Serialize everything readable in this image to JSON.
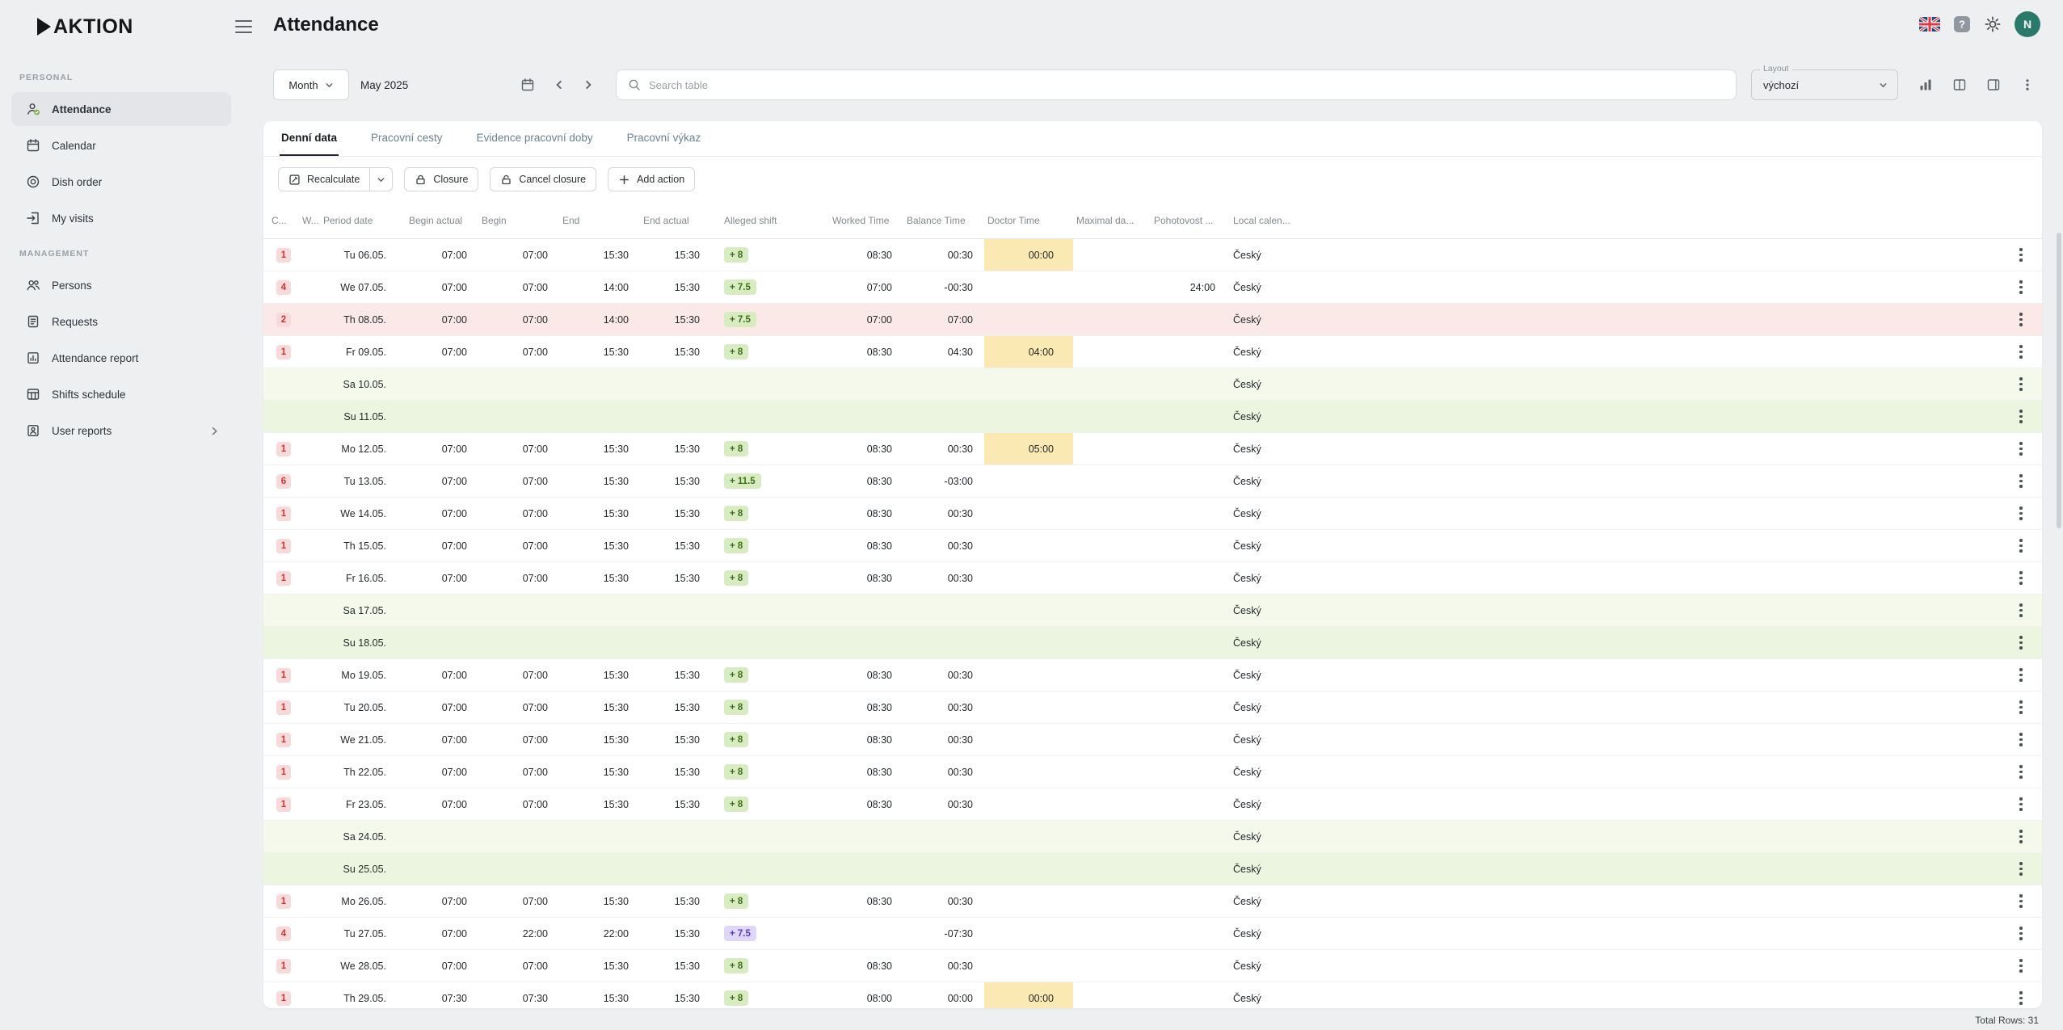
{
  "brand": {
    "logo_text": "AKTION"
  },
  "sidebar": {
    "sections": [
      {
        "label": "PERSONAL",
        "items": [
          {
            "id": "attendance",
            "label": "Attendance",
            "icon": "attendance-icon",
            "active": true
          },
          {
            "id": "calendar",
            "label": "Calendar",
            "icon": "calendar-icon"
          },
          {
            "id": "dish-order",
            "label": "Dish order",
            "icon": "dish-icon"
          },
          {
            "id": "my-visits",
            "label": "My visits",
            "icon": "visits-icon"
          }
        ]
      },
      {
        "label": "MANAGEMENT",
        "items": [
          {
            "id": "persons",
            "label": "Persons",
            "icon": "persons-icon"
          },
          {
            "id": "requests",
            "label": "Requests",
            "icon": "requests-icon"
          },
          {
            "id": "attendance-report",
            "label": "Attendance report",
            "icon": "report-icon"
          },
          {
            "id": "shifts-schedule",
            "label": "Shifts schedule",
            "icon": "schedule-icon"
          },
          {
            "id": "user-reports",
            "label": "User reports",
            "icon": "user-reports-icon",
            "chevron": true
          }
        ]
      }
    ]
  },
  "header": {
    "title": "Attendance",
    "avatar_initial": "N"
  },
  "toolbar": {
    "period_mode": "Month",
    "period_value": "May 2025",
    "search_placeholder": "Search table",
    "layout_label": "Layout",
    "layout_value": "výchozí"
  },
  "tabs": [
    {
      "id": "denni-data",
      "label": "Denní data",
      "active": true
    },
    {
      "id": "pracovni-cesty",
      "label": "Pracovní cesty"
    },
    {
      "id": "evidence-pracovni-doby",
      "label": "Evidence pracovní doby"
    },
    {
      "id": "pracovni-vykaz",
      "label": "Pracovní výkaz"
    }
  ],
  "actions": {
    "recalculate": "Recalculate",
    "closure": "Closure",
    "cancel_closure": "Cancel closure",
    "add_action": "Add action"
  },
  "table": {
    "columns": [
      {
        "id": "count",
        "label": "C..."
      },
      {
        "id": "week",
        "label": "W..."
      },
      {
        "id": "period-date",
        "label": "Period date"
      },
      {
        "id": "begin-actual",
        "label": "Begin actual"
      },
      {
        "id": "begin",
        "label": "Begin"
      },
      {
        "id": "end",
        "label": "End"
      },
      {
        "id": "end-actual",
        "label": "End actual"
      },
      {
        "id": "alleged-shift",
        "label": "Alleged shift"
      },
      {
        "id": "worked-time",
        "label": "Worked Time"
      },
      {
        "id": "balance-time",
        "label": "Balance Time"
      },
      {
        "id": "doctor-time",
        "label": "Doctor Time"
      },
      {
        "id": "maximal-day",
        "label": "Maximal da..."
      },
      {
        "id": "standby",
        "label": "Pohotovost ..."
      },
      {
        "id": "local-calendar",
        "label": "Local calen..."
      }
    ],
    "rows": [
      {
        "count": "1",
        "date": "Tu 06.05.",
        "begin_actual": "07:00",
        "begin": "07:00",
        "end": "15:30",
        "end_actual": "15:30",
        "shift": "+ 8",
        "shift_style": "green",
        "worked": "08:30",
        "balance": "00:30",
        "doctor": "00:00",
        "maximal": "",
        "standby": "",
        "calendar": "Český",
        "style": "normal"
      },
      {
        "count": "4",
        "date": "We 07.05.",
        "begin_actual": "07:00",
        "begin": "07:00",
        "end": "14:00",
        "end_actual": "15:30",
        "shift": "+ 7.5",
        "shift_style": "green",
        "worked": "07:00",
        "balance": "-00:30",
        "doctor": "",
        "maximal": "",
        "standby": "24:00",
        "calendar": "Český",
        "style": "normal"
      },
      {
        "count": "2",
        "date": "Th 08.05.",
        "begin_actual": "07:00",
        "begin": "07:00",
        "end": "14:00",
        "end_actual": "15:30",
        "shift": "+ 7.5",
        "shift_style": "green",
        "worked": "07:00",
        "balance": "07:00",
        "doctor": "",
        "maximal": "",
        "standby": "",
        "calendar": "Český",
        "style": "alert"
      },
      {
        "count": "1",
        "date": "Fr 09.05.",
        "begin_actual": "07:00",
        "begin": "07:00",
        "end": "15:30",
        "end_actual": "15:30",
        "shift": "+ 8",
        "shift_style": "green",
        "worked": "08:30",
        "balance": "04:30",
        "doctor": "04:00",
        "maximal": "",
        "standby": "",
        "calendar": "Český",
        "style": "normal"
      },
      {
        "count": "",
        "date": "Sa 10.05.",
        "begin_actual": "",
        "begin": "",
        "end": "",
        "end_actual": "",
        "shift": "",
        "shift_style": "",
        "worked": "",
        "balance": "",
        "doctor": "",
        "maximal": "",
        "standby": "",
        "calendar": "Český",
        "style": "weekend-sa"
      },
      {
        "count": "",
        "date": "Su 11.05.",
        "begin_actual": "",
        "begin": "",
        "end": "",
        "end_actual": "",
        "shift": "",
        "shift_style": "",
        "worked": "",
        "balance": "",
        "doctor": "",
        "maximal": "",
        "standby": "",
        "calendar": "Český",
        "style": "weekend-su"
      },
      {
        "count": "1",
        "date": "Mo 12.05.",
        "begin_actual": "07:00",
        "begin": "07:00",
        "end": "15:30",
        "end_actual": "15:30",
        "shift": "+ 8",
        "shift_style": "green",
        "worked": "08:30",
        "balance": "00:30",
        "doctor": "05:00",
        "maximal": "",
        "standby": "",
        "calendar": "Český",
        "style": "normal"
      },
      {
        "count": "6",
        "date": "Tu 13.05.",
        "begin_actual": "07:00",
        "begin": "07:00",
        "end": "15:30",
        "end_actual": "15:30",
        "shift": "+ 11.5",
        "shift_style": "green",
        "worked": "08:30",
        "balance": "-03:00",
        "doctor": "",
        "maximal": "",
        "standby": "",
        "calendar": "Český",
        "style": "normal"
      },
      {
        "count": "1",
        "date": "We 14.05.",
        "begin_actual": "07:00",
        "begin": "07:00",
        "end": "15:30",
        "end_actual": "15:30",
        "shift": "+ 8",
        "shift_style": "green",
        "worked": "08:30",
        "balance": "00:30",
        "doctor": "",
        "maximal": "",
        "standby": "",
        "calendar": "Český",
        "style": "normal"
      },
      {
        "count": "1",
        "date": "Th 15.05.",
        "begin_actual": "07:00",
        "begin": "07:00",
        "end": "15:30",
        "end_actual": "15:30",
        "shift": "+ 8",
        "shift_style": "green",
        "worked": "08:30",
        "balance": "00:30",
        "doctor": "",
        "maximal": "",
        "standby": "",
        "calendar": "Český",
        "style": "normal"
      },
      {
        "count": "1",
        "date": "Fr 16.05.",
        "begin_actual": "07:00",
        "begin": "07:00",
        "end": "15:30",
        "end_actual": "15:30",
        "shift": "+ 8",
        "shift_style": "green",
        "worked": "08:30",
        "balance": "00:30",
        "doctor": "",
        "maximal": "",
        "standby": "",
        "calendar": "Český",
        "style": "normal"
      },
      {
        "count": "",
        "date": "Sa 17.05.",
        "begin_actual": "",
        "begin": "",
        "end": "",
        "end_actual": "",
        "shift": "",
        "shift_style": "",
        "worked": "",
        "balance": "",
        "doctor": "",
        "maximal": "",
        "standby": "",
        "calendar": "Český",
        "style": "weekend-sa"
      },
      {
        "count": "",
        "date": "Su 18.05.",
        "begin_actual": "",
        "begin": "",
        "end": "",
        "end_actual": "",
        "shift": "",
        "shift_style": "",
        "worked": "",
        "balance": "",
        "doctor": "",
        "maximal": "",
        "standby": "",
        "calendar": "Český",
        "style": "weekend-su"
      },
      {
        "count": "1",
        "date": "Mo 19.05.",
        "begin_actual": "07:00",
        "begin": "07:00",
        "end": "15:30",
        "end_actual": "15:30",
        "shift": "+ 8",
        "shift_style": "green",
        "worked": "08:30",
        "balance": "00:30",
        "doctor": "",
        "maximal": "",
        "standby": "",
        "calendar": "Český",
        "style": "normal"
      },
      {
        "count": "1",
        "date": "Tu 20.05.",
        "begin_actual": "07:00",
        "begin": "07:00",
        "end": "15:30",
        "end_actual": "15:30",
        "shift": "+ 8",
        "shift_style": "green",
        "worked": "08:30",
        "balance": "00:30",
        "doctor": "",
        "maximal": "",
        "standby": "",
        "calendar": "Český",
        "style": "normal"
      },
      {
        "count": "1",
        "date": "We 21.05.",
        "begin_actual": "07:00",
        "begin": "07:00",
        "end": "15:30",
        "end_actual": "15:30",
        "shift": "+ 8",
        "shift_style": "green",
        "worked": "08:30",
        "balance": "00:30",
        "doctor": "",
        "maximal": "",
        "standby": "",
        "calendar": "Český",
        "style": "normal"
      },
      {
        "count": "1",
        "date": "Th 22.05.",
        "begin_actual": "07:00",
        "begin": "07:00",
        "end": "15:30",
        "end_actual": "15:30",
        "shift": "+ 8",
        "shift_style": "green",
        "worked": "08:30",
        "balance": "00:30",
        "doctor": "",
        "maximal": "",
        "standby": "",
        "calendar": "Český",
        "style": "normal"
      },
      {
        "count": "1",
        "date": "Fr 23.05.",
        "begin_actual": "07:00",
        "begin": "07:00",
        "end": "15:30",
        "end_actual": "15:30",
        "shift": "+ 8",
        "shift_style": "green",
        "worked": "08:30",
        "balance": "00:30",
        "doctor": "",
        "maximal": "",
        "standby": "",
        "calendar": "Český",
        "style": "normal"
      },
      {
        "count": "",
        "date": "Sa 24.05.",
        "begin_actual": "",
        "begin": "",
        "end": "",
        "end_actual": "",
        "shift": "",
        "shift_style": "",
        "worked": "",
        "balance": "",
        "doctor": "",
        "maximal": "",
        "standby": "",
        "calendar": "Český",
        "style": "weekend-sa"
      },
      {
        "count": "",
        "date": "Su 25.05.",
        "begin_actual": "",
        "begin": "",
        "end": "",
        "end_actual": "",
        "shift": "",
        "shift_style": "",
        "worked": "",
        "balance": "",
        "doctor": "",
        "maximal": "",
        "standby": "",
        "calendar": "Český",
        "style": "weekend-su"
      },
      {
        "count": "1",
        "date": "Mo 26.05.",
        "begin_actual": "07:00",
        "begin": "07:00",
        "end": "15:30",
        "end_actual": "15:30",
        "shift": "+ 8",
        "shift_style": "green",
        "worked": "08:30",
        "balance": "00:30",
        "doctor": "",
        "maximal": "",
        "standby": "",
        "calendar": "Český",
        "style": "normal"
      },
      {
        "count": "4",
        "date": "Tu 27.05.",
        "begin_actual": "07:00",
        "begin": "22:00",
        "end": "22:00",
        "end_actual": "15:30",
        "shift": "+ 7.5",
        "shift_style": "purple",
        "worked": "",
        "balance": "-07:30",
        "doctor": "",
        "maximal": "",
        "standby": "",
        "calendar": "Český",
        "style": "normal"
      },
      {
        "count": "1",
        "date": "We 28.05.",
        "begin_actual": "07:00",
        "begin": "07:00",
        "end": "15:30",
        "end_actual": "15:30",
        "shift": "+ 8",
        "shift_style": "green",
        "worked": "08:30",
        "balance": "00:30",
        "doctor": "",
        "maximal": "",
        "standby": "",
        "calendar": "Český",
        "style": "normal"
      },
      {
        "count": "1",
        "date": "Th 29.05.",
        "begin_actual": "07:30",
        "begin": "07:30",
        "end": "15:30",
        "end_actual": "15:30",
        "shift": "+ 8",
        "shift_style": "green",
        "worked": "08:00",
        "balance": "00:00",
        "doctor": "00:00",
        "maximal": "",
        "standby": "",
        "calendar": "Český",
        "style": "normal"
      }
    ],
    "total_label": "Total Rows: 31"
  },
  "colors": {
    "badge_red_bg": "#f9dada",
    "badge_red_text": "#cf3434",
    "shift_green_bg": "#d7ecc1",
    "shift_green_text": "#3f6d1b",
    "shift_purple_bg": "#ded7f9",
    "shift_purple_text": "#5b3bc0",
    "doctor_yellow_bg": "#fbe9b3",
    "weekend_sa_bg": "#f4f9ec",
    "weekend_su_bg": "#ecf5df",
    "alert_row_bg": "#fbe9e7",
    "avatar_bg": "#2a7a6b",
    "active_item_bg": "#e3e5e8"
  }
}
